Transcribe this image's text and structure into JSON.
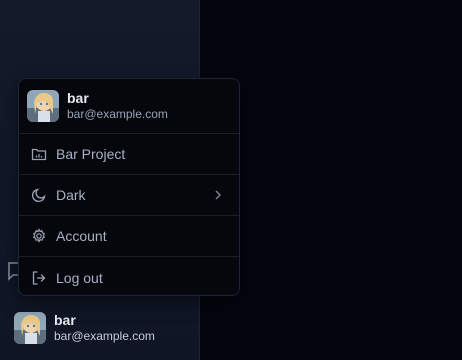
{
  "user": {
    "name": "bar",
    "email": "bar@example.com"
  },
  "menu": {
    "items": [
      {
        "label": "Bar Project",
        "icon": "folder-chart-icon"
      },
      {
        "label": "Dark",
        "icon": "moon-icon",
        "submenu": true
      },
      {
        "label": "Account",
        "icon": "gear-icon"
      },
      {
        "label": "Log out",
        "icon": "logout-icon"
      }
    ]
  },
  "colors": {
    "background": "#03060e",
    "sidebar": "#131a2a",
    "menu_bg": "#05070d",
    "border": "#1e2433",
    "text_primary": "#e6e9ef",
    "text_secondary": "#a9b1c2"
  }
}
